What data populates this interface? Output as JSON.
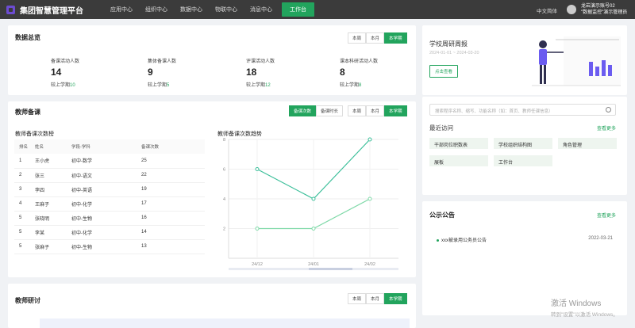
{
  "app": {
    "title": "集团智慧管理平台"
  },
  "nav": [
    {
      "label": "应用中心"
    },
    {
      "label": "组织中心"
    },
    {
      "label": "数据中心"
    },
    {
      "label": "物联中心"
    },
    {
      "label": "消息中心"
    },
    {
      "label": "工作台"
    }
  ],
  "header": {
    "lang": "中文简体",
    "user_line1": "龙岩演示账号02",
    "user_line2": "\"数据监控\"演示管理员"
  },
  "overview": {
    "title": "数据总览",
    "tabs": [
      "本周",
      "本月",
      "本学期"
    ],
    "stats": [
      {
        "label": "备课活动人数",
        "value": "14",
        "compare_label": "较上学期",
        "compare_value": "10"
      },
      {
        "label": "集体备课人数",
        "value": "9",
        "compare_label": "较上学期",
        "compare_value": "5"
      },
      {
        "label": "评课活动人数",
        "value": "18",
        "compare_label": "较上学期",
        "compare_value": "12"
      },
      {
        "label": "课本科研活动人数",
        "value": "8",
        "compare_label": "较上学期",
        "compare_value": "8"
      }
    ]
  },
  "prep": {
    "title": "教师备课",
    "toggles": [
      "备课次数",
      "备课时长"
    ],
    "tabs": [
      "本周",
      "本月",
      "本学期"
    ],
    "rank_title": "教师备课次数榜",
    "columns": [
      "排名",
      "姓名",
      "学段-学科",
      "备课次数"
    ],
    "rows": [
      [
        "1",
        "王小虎",
        "初中-数学",
        "25"
      ],
      [
        "2",
        "张三",
        "初中-语文",
        "22"
      ],
      [
        "3",
        "李四",
        "初中-英语",
        "19"
      ],
      [
        "4",
        "王麻子",
        "初中-化学",
        "17"
      ],
      [
        "5",
        "张晓明",
        "初中-生物",
        "16"
      ],
      [
        "5",
        "李某",
        "初中-化学",
        "14"
      ],
      [
        "5",
        "张麻子",
        "初中-生物",
        "13"
      ]
    ],
    "trend_title": "教师备课次数趋势"
  },
  "chart_data": {
    "type": "line",
    "categories": [
      "24/12",
      "24/01",
      "24/02"
    ],
    "series": [
      {
        "values": [
          6,
          4,
          8
        ]
      },
      {
        "values": [
          2,
          2,
          4
        ]
      }
    ],
    "y_ticks": [
      "8",
      "6",
      "4",
      "2"
    ],
    "ylim": [
      0,
      8
    ],
    "grid": true,
    "colors": [
      "#3cbf9a",
      "#7fd9a8"
    ]
  },
  "research": {
    "title": "教师研讨",
    "tabs": [
      "本周",
      "本月",
      "本学期"
    ]
  },
  "banner": {
    "title": "学校周研周报",
    "date_range": "2024-01-01 ~ 2024-03-20",
    "button": "点击查看"
  },
  "quick": {
    "search_placeholder": "搜索程序名称、缩写、功能名称（如：首页、教师任课信息）",
    "recent_title": "最近访问",
    "more": "查看更多",
    "links": [
      "干部岗位职数表",
      "学校组织结构图",
      "角色管理",
      "展板",
      "工作台"
    ]
  },
  "notice": {
    "title": "公示公告",
    "more": "查看更多",
    "items": [
      {
        "title": "xxx被录用公务员公告",
        "date": "2022-03-21"
      }
    ]
  },
  "watermark": {
    "line1": "激活 Windows",
    "line2": "转到\"设置\"以激活 Windows。"
  }
}
